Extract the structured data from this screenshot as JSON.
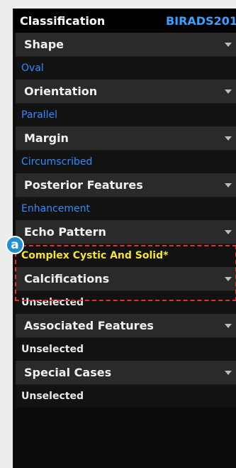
{
  "panel": {
    "title": "Classification",
    "standard": "BIRADS201"
  },
  "groups": [
    {
      "title": "Shape",
      "value": "Oval"
    },
    {
      "title": "Orientation",
      "value": "Parallel"
    },
    {
      "title": "Margin",
      "value": "Circumscribed"
    },
    {
      "title": "Posterior Features",
      "value": "Enhancement"
    },
    {
      "title": "Echo Pattern",
      "value": "Complex Cystic And Solid*"
    },
    {
      "title": "Calcifications",
      "value": "Unselected"
    },
    {
      "title": "Associated Features",
      "value": "Unselected"
    },
    {
      "title": "Special Cases",
      "value": "Unselected"
    }
  ],
  "annotation": {
    "badge": "a"
  },
  "colors": {
    "blue_value": "#2f8cff",
    "yellow_value": "#f4e23a",
    "highlight": "#e0322f",
    "badge_bg": "#1f8fd0"
  }
}
